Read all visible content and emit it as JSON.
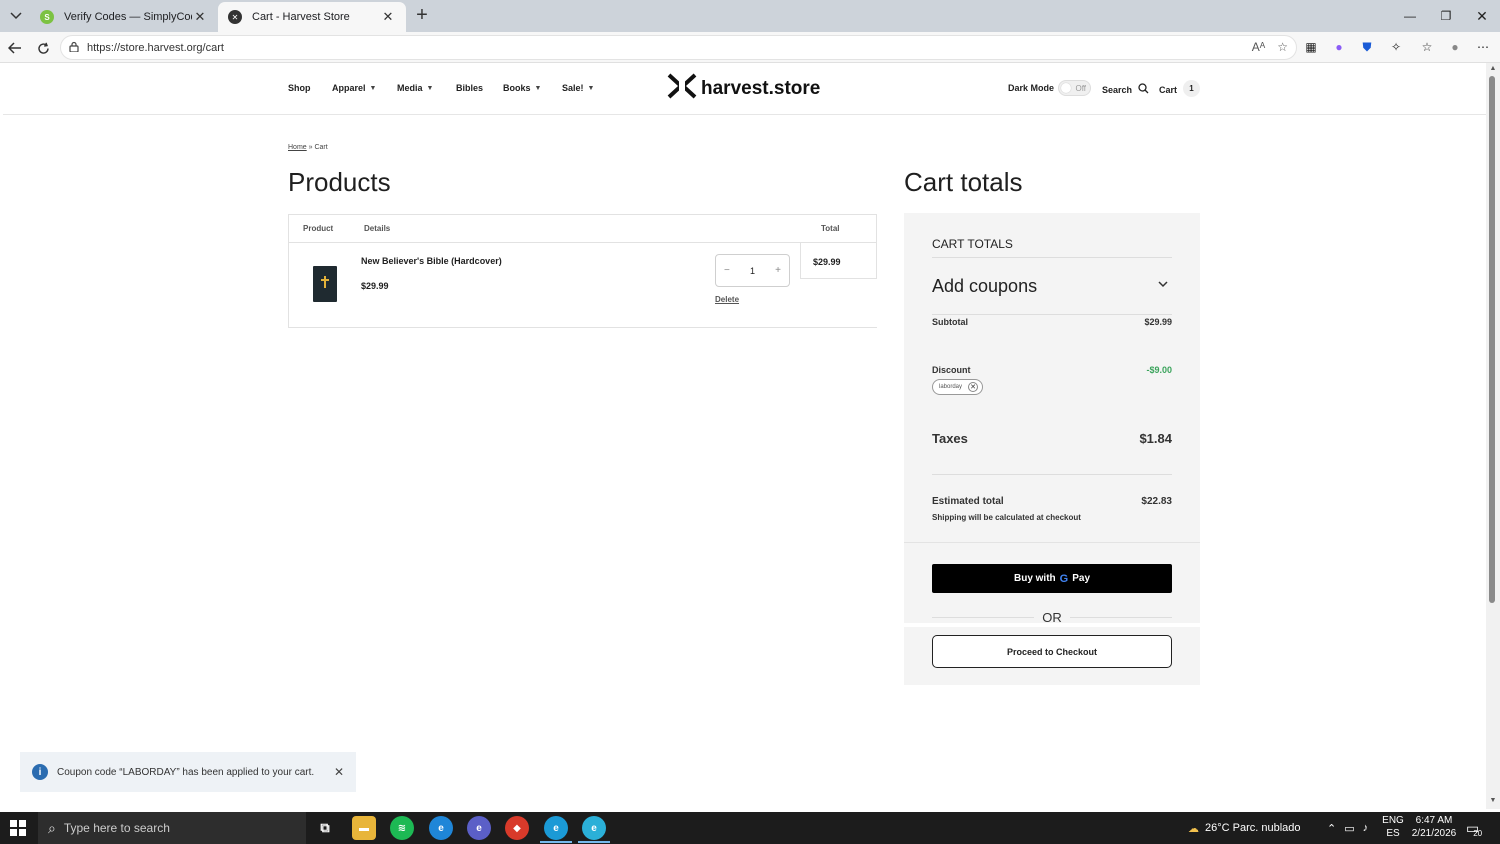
{
  "browser": {
    "tabs": [
      {
        "title": "Verify Codes — SimplyCodes",
        "active": false
      },
      {
        "title": "Cart - Harvest Store",
        "active": true
      }
    ],
    "url": "https://store.harvest.org/cart"
  },
  "header": {
    "nav": [
      {
        "label": "Shop",
        "dropdown": false
      },
      {
        "label": "Apparel",
        "dropdown": true
      },
      {
        "label": "Media",
        "dropdown": true
      },
      {
        "label": "Bibles",
        "dropdown": false
      },
      {
        "label": "Books",
        "dropdown": true
      },
      {
        "label": "Sale!",
        "dropdown": true
      }
    ],
    "logo_text": "harvest.store",
    "dark_mode_label": "Dark Mode",
    "dark_mode_state": "Off",
    "search_label": "Search",
    "cart_label": "Cart",
    "cart_count": "1"
  },
  "breadcrumb": {
    "home": "Home",
    "sep": " » ",
    "current": "Cart"
  },
  "products": {
    "title": "Products",
    "columns": {
      "product": "Product",
      "details": "Details",
      "total": "Total"
    },
    "items": [
      {
        "name": "New Believer's Bible (Hardcover)",
        "price": "$29.99",
        "quantity": "1",
        "delete_label": "Delete",
        "total": "$29.99"
      }
    ]
  },
  "totals": {
    "title": "Cart totals",
    "heading": "CART TOTALS",
    "coupons_label": "Add coupons",
    "subtotal_label": "Subtotal",
    "subtotal_value": "$29.99",
    "discount_label": "Discount",
    "discount_value": "-$9.00",
    "coupon_chip": "laborday",
    "taxes_label": "Taxes",
    "taxes_value": "$1.84",
    "estimated_label": "Estimated total",
    "estimated_value": "$22.83",
    "shipping_note": "Shipping will be calculated at checkout",
    "gpay_label": "Buy with",
    "gpay_brand": "Pay",
    "or_label": "OR",
    "checkout_label": "Proceed to Checkout"
  },
  "toast": {
    "message": "Coupon code “LABORDAY” has been applied to your cart."
  },
  "taskbar": {
    "search_placeholder": "Type here to search",
    "weather": "26°C  Parc. nublado",
    "lang": "ENG",
    "region": "ES",
    "time": "6:47 AM",
    "date": "2/21/2026",
    "notifications": "20"
  },
  "colors": {
    "discount": "#3aa35b",
    "accent": "#000000"
  }
}
